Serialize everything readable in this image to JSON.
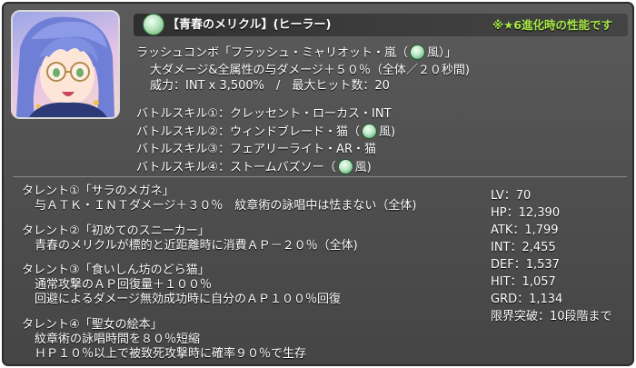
{
  "header": {
    "title": "【青春のメリクル】(ヒーラー)",
    "note": "※★6進化時の性能です",
    "icon": "wind-element-icon"
  },
  "rush": {
    "line1_a": "ラッシュコンボ「フラッシュ・ミャリオット・嵐（",
    "line1_b": "風）」",
    "line2": "大ダメージ&全属性の与ダメージ＋５０％（全体／２０秒間)",
    "line3": "威力：INT x 3,500%　/　最大ヒット数：20"
  },
  "skills": [
    {
      "text_a": "バトルスキル①：クレッセント・ローカス・INT",
      "text_b": "",
      "wind": false
    },
    {
      "text_a": "バトルスキル②：ウィンドブレード・猫（",
      "text_b": "風)",
      "wind": true
    },
    {
      "text_a": "バトルスキル③：フェアリーライト・AR・猫",
      "text_b": "",
      "wind": false
    },
    {
      "text_a": "バトルスキル④：ストームバズソー（",
      "text_b": "風)",
      "wind": true
    }
  ],
  "talents": [
    {
      "title": "タレント①「サラのメガネ」",
      "lines": [
        "与ＡＴＫ・ＩＮＴダメージ＋３０％　紋章術の詠唱中は怯まない（全体)"
      ]
    },
    {
      "title": "タレント②「初めてのスニーカー」",
      "lines": [
        "青春のメリクルが標的と近距離時に消費ＡＰ－２０％（全体)"
      ]
    },
    {
      "title": "タレント③「食いしん坊のどら猫」",
      "lines": [
        "通常攻撃のＡＰ回復量＋１００％",
        "回避によるダメージ無効成功時に自分のＡＰ１００％回復"
      ]
    },
    {
      "title": "タレント④「聖女の絵本」",
      "lines": [
        "紋章術の詠唱時間を８０％短縮",
        "ＨＰ１０％以上で被致死攻撃時に確率９０％で生存"
      ]
    }
  ],
  "stats": [
    "LV：70",
    "HP：12,390",
    "ATK：1,799",
    "INT：2,455",
    "DEF：1,537",
    "HIT：1,057",
    "GRD：1,134",
    "限界突破：10段階まで"
  ],
  "colors": {
    "panel": "#505050",
    "header_bar": "#333333",
    "note_green": "#a8e84a",
    "text": "#ffffff"
  }
}
